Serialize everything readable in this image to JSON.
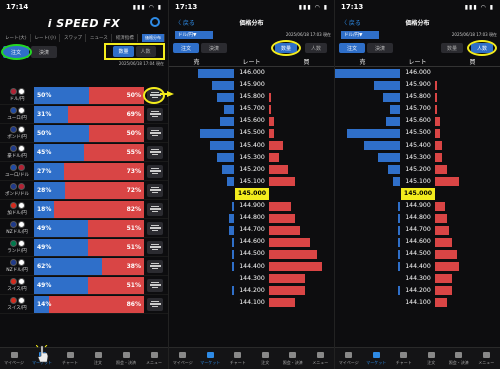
{
  "panel1": {
    "status_time": "17:14",
    "status_icons": "▮▮▮ ◠ ▮",
    "logo": "i SPEED FX",
    "tabs": [
      "レート(大)",
      "レート(小)",
      "スワップ",
      "ニュース",
      "経済指標"
    ],
    "tab_button": "価格分布",
    "order_label": "注文",
    "settle_label": "決済",
    "toggle_on": "数量",
    "toggle_off": "人数",
    "timestamp": "2025/06/18 17:04 現在",
    "rows": [
      {
        "pair": "ドル/円",
        "sell": 50,
        "sell_label": "50%",
        "buy_label": "50%",
        "c1": "#b22234",
        "c2": "#ffffff"
      },
      {
        "pair": "ユーロ/円",
        "sell": 31,
        "sell_label": "31%",
        "buy_label": "69%",
        "c1": "#1f4ba5",
        "c2": "#ffffff"
      },
      {
        "pair": "ポンド/円",
        "sell": 50,
        "sell_label": "50%",
        "buy_label": "50%",
        "c1": "#1f3a8a",
        "c2": "#ffffff"
      },
      {
        "pair": "豪ドル/円",
        "sell": 45,
        "sell_label": "45%",
        "buy_label": "55%",
        "c1": "#1f3a8a",
        "c2": "#ffffff"
      },
      {
        "pair": "ユーロ/ドル",
        "sell": 27,
        "sell_label": "27%",
        "buy_label": "73%",
        "c1": "#1f4ba5",
        "c2": "#b22234"
      },
      {
        "pair": "ポンド/ドル",
        "sell": 28,
        "sell_label": "28%",
        "buy_label": "72%",
        "c1": "#1f3a8a",
        "c2": "#b22234"
      },
      {
        "pair": "加ドル/円",
        "sell": 18,
        "sell_label": "18%",
        "buy_label": "82%",
        "c1": "#d52b1e",
        "c2": "#ffffff"
      },
      {
        "pair": "NZドル/円",
        "sell": 49,
        "sell_label": "49%",
        "buy_label": "51%",
        "c1": "#1f3a8a",
        "c2": "#ffffff"
      },
      {
        "pair": "ランド/円",
        "sell": 49,
        "sell_label": "49%",
        "buy_label": "51%",
        "c1": "#007a4d",
        "c2": "#ffffff"
      },
      {
        "pair": "NZドル/円",
        "sell": 62,
        "sell_label": "62%",
        "buy_label": "38%",
        "c1": "#1f3a8a",
        "c2": "#ffffff"
      },
      {
        "pair": "スイス/円",
        "sell": 49,
        "sell_label": "49%",
        "buy_label": "51%",
        "c1": "#d52b1e",
        "c2": "#ffffff"
      },
      {
        "pair": "スイス/円",
        "sell": 14,
        "sell_label": "14%",
        "buy_label": "86%",
        "c1": "#d52b1e",
        "c2": "#ffffff"
      }
    ],
    "nav": [
      "マイページ",
      "マーケット",
      "チャート",
      "注文",
      "照会・決済",
      "メニュー"
    ]
  },
  "panel2": {
    "status_time": "17:13",
    "back": "〈 戻る",
    "title": "価格分布",
    "pair_select": "ドル/円▼",
    "timestamp": "2025/06/18 17:03 現在",
    "order_label": "注文",
    "settle_label": "決済",
    "toggle_on": "数量",
    "toggle_off": "人数",
    "sell_header": "売",
    "rate_header": "レート",
    "buy_header": "買",
    "nav": [
      "マイページ",
      "マーケット",
      "チャート",
      "注文",
      "照会・決済",
      "メニュー"
    ]
  },
  "panel3": {
    "status_time": "17:13",
    "back": "〈 戻る",
    "title": "価格分布",
    "pair_select": "ドル/円▼",
    "timestamp": "2025/06/18 17:03 現在",
    "order_label": "注文",
    "settle_label": "決済",
    "toggle_on": "人数",
    "toggle_off": "数量",
    "sell_header": "売",
    "rate_header": "レート",
    "buy_header": "買",
    "nav": [
      "マイページ",
      "マーケット",
      "チャート",
      "注文",
      "照会・決済",
      "メニュー"
    ]
  },
  "chart_data": [
    {
      "type": "bar",
      "title": "価格分布",
      "current_price": "145.000",
      "prices": [
        "146.000",
        "145.900",
        "145.800",
        "145.700",
        "145.600",
        "145.500",
        "145.400",
        "145.300",
        "145.200",
        "145.100",
        "145.000",
        "144.900",
        "144.800",
        "144.700",
        "144.600",
        "144.500",
        "144.400",
        "144.300",
        "144.200",
        "144.100"
      ],
      "series": [
        {
          "name": "売",
          "values": [
            30,
            18,
            14,
            8,
            12,
            28,
            20,
            14,
            10,
            6,
            0,
            2,
            4,
            4,
            2,
            2,
            2,
            0,
            2,
            0
          ]
        },
        {
          "name": "買",
          "values": [
            0,
            0,
            2,
            2,
            4,
            4,
            12,
            8,
            16,
            22,
            0,
            18,
            22,
            26,
            34,
            40,
            44,
            30,
            30,
            22
          ]
        }
      ]
    },
    {
      "type": "bar",
      "title": "価格分布",
      "current_price": "145.000",
      "prices": [
        "146.000",
        "145.900",
        "145.800",
        "145.700",
        "145.600",
        "145.500",
        "145.400",
        "145.300",
        "145.200",
        "145.100",
        "145.000",
        "144.900",
        "144.800",
        "144.700",
        "144.600",
        "144.500",
        "144.400",
        "144.300",
        "144.200",
        "144.100"
      ],
      "series": [
        {
          "name": "売",
          "values": [
            54,
            22,
            14,
            8,
            12,
            44,
            30,
            18,
            10,
            6,
            0,
            2,
            2,
            2,
            2,
            2,
            2,
            0,
            2,
            0
          ]
        },
        {
          "name": "買",
          "values": [
            0,
            2,
            2,
            2,
            4,
            4,
            6,
            6,
            10,
            20,
            0,
            8,
            10,
            12,
            14,
            18,
            20,
            14,
            14,
            10
          ]
        }
      ]
    }
  ]
}
